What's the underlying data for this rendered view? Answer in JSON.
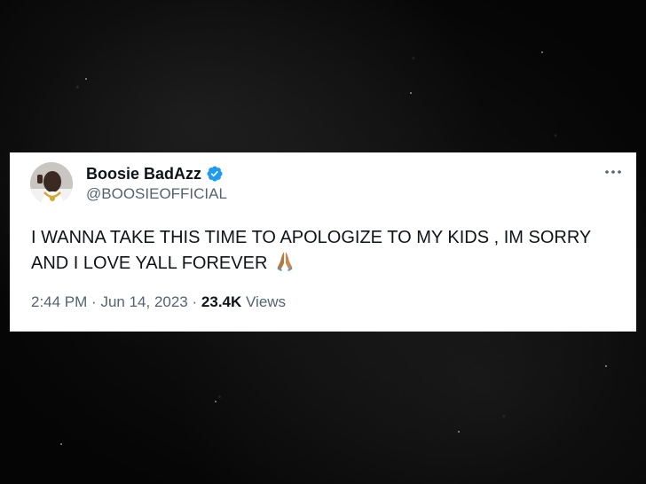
{
  "tweet": {
    "display_name": "Boosie BadAzz",
    "handle": "@BOOSIEOFFICIAL",
    "text": "I WANNA TAKE THIS TIME TO APOLOGIZE TO MY KIDS , IM SORRY AND I LOVE YALL FOREVER",
    "time": "2:44 PM",
    "separator": "·",
    "date": "Jun 14, 2023",
    "views_count": "23.4K",
    "views_label": "Views"
  },
  "icons": {
    "verified": "verified-badge-icon",
    "more": "more-options-icon",
    "emoji": "folded-hands-emoji"
  },
  "colors": {
    "verified_blue": "#1d9bf0",
    "text_primary": "#0f1419",
    "text_secondary": "#536471",
    "card_background": "#ffffff",
    "page_background": "#0b0b0b"
  }
}
